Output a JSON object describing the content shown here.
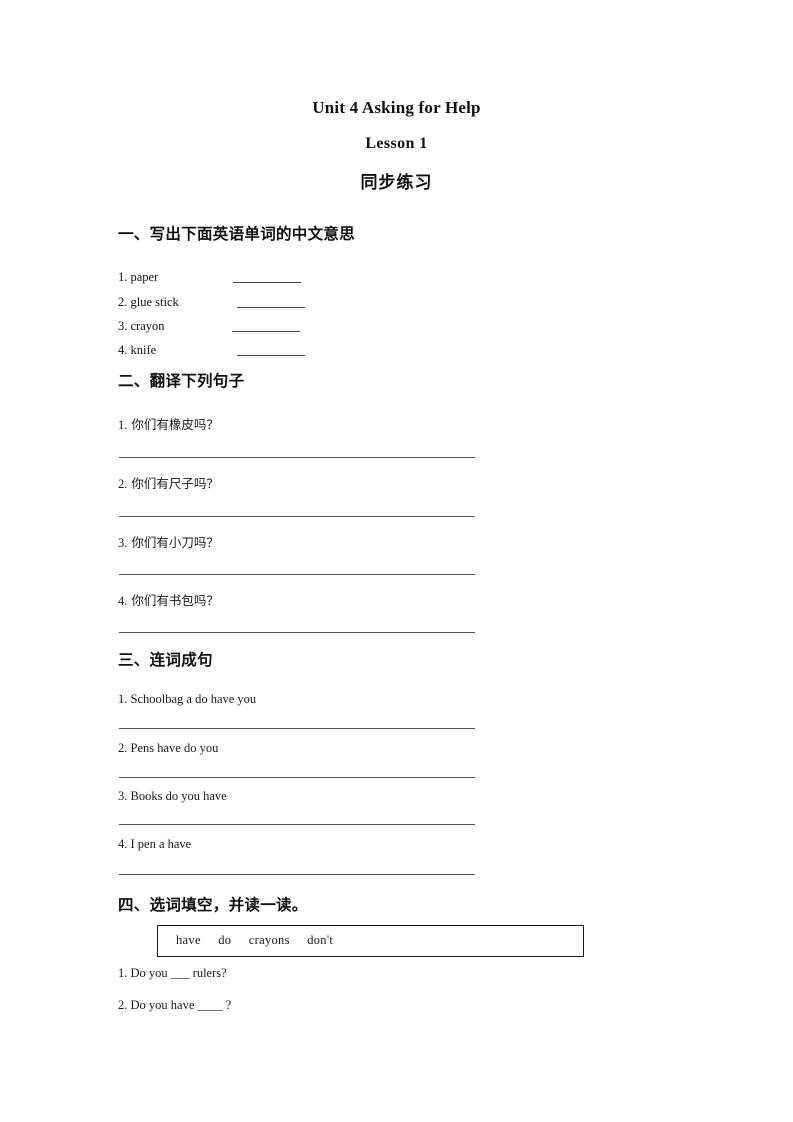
{
  "document": {
    "title_main": "Unit 4 Asking for Help",
    "title_sub": "Lesson 1",
    "title_cn": "同步练习"
  },
  "sections": [
    {
      "heading": "一、写出下面英语单词的中文意思",
      "type": "vocabulary",
      "items": [
        {
          "number": "1.",
          "term": "paper"
        },
        {
          "number": "2.",
          "term": "glue  stick"
        },
        {
          "number": "3.",
          "term": "crayon"
        },
        {
          "number": "4.",
          "term": "knife"
        }
      ]
    },
    {
      "heading": "二、翻译下列句子",
      "type": "translate",
      "items": [
        {
          "number": "1.",
          "text": "你们有橡皮吗？"
        },
        {
          "number": "2.",
          "text": "你们有尺子吗？"
        },
        {
          "number": "3.",
          "text": "你们有小刀吗？"
        },
        {
          "number": "4.",
          "text": "你们有书包吗？"
        }
      ]
    },
    {
      "heading": "三、连词成句",
      "type": "unscramble",
      "items": [
        {
          "number": "1.",
          "text": "Schoolbag a do have you"
        },
        {
          "number": "2.",
          "text": "Pens have do you"
        },
        {
          "number": "3.",
          "text": "Books do you have"
        },
        {
          "number": "4.",
          "text": " I pen a have"
        }
      ]
    },
    {
      "heading": "四、选词填空，并读一读。",
      "type": "fill-in-blank",
      "word_bank": [
        "have",
        "do",
        "crayons",
        "don't"
      ],
      "items": [
        {
          "number": "1.",
          "text": " Do you ___ rulers?"
        },
        {
          "number": "2.",
          "text": "Do you have ____ ?"
        }
      ]
    }
  ]
}
